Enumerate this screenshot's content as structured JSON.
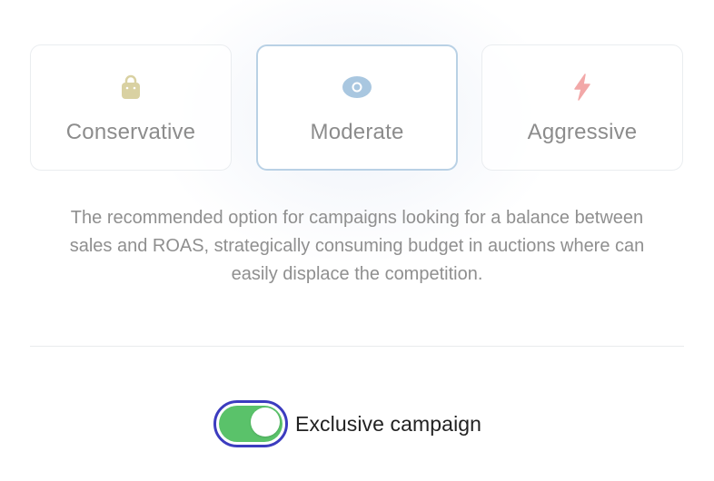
{
  "strategy": {
    "options": [
      {
        "label": "Conservative",
        "icon": "shopping-bag-icon",
        "icon_color": "#d9d1a2",
        "selected": false
      },
      {
        "label": "Moderate",
        "icon": "eye-icon",
        "icon_color": "#a9c7e0",
        "selected": true
      },
      {
        "label": "Aggressive",
        "icon": "lightning-bolt-icon",
        "icon_color": "#f2a8a8",
        "selected": false
      }
    ],
    "description": "The recommended option for campaigns looking for a balance between sales and ROAS, strategically consuming budget in auctions where can easily displace the competition."
  },
  "exclusive": {
    "label": "Exclusive campaign",
    "enabled": true
  },
  "colors": {
    "selected_border": "#b9d1e5",
    "toggle_on": "#5ac26a",
    "toggle_focus_ring": "#3c3cbf"
  }
}
